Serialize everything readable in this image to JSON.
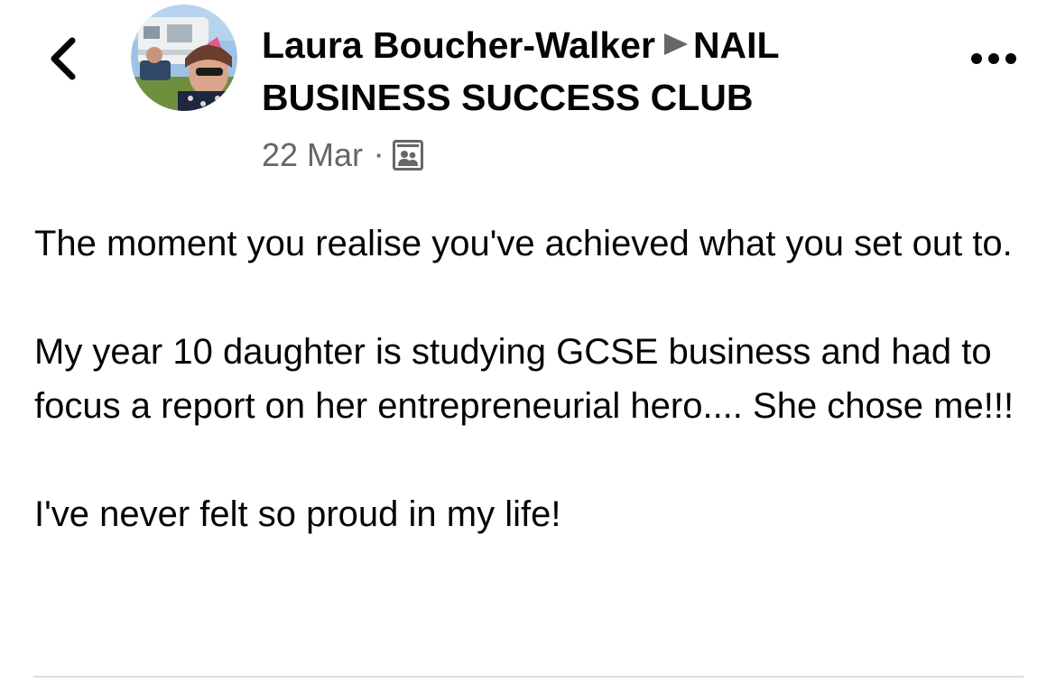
{
  "header": {
    "back_icon": "chevron-left-icon",
    "avatar_alt": "profile photo",
    "author": "Laura Boucher-Walker",
    "separator_icon": "play-triangle-icon",
    "group": "NAIL BUSINESS SUCCESS CLUB",
    "date": "22 Mar",
    "dot": "·",
    "audience_icon": "group-audience-icon",
    "more_icon": "more-horizontal-icon"
  },
  "post": {
    "paragraphs": [
      "The moment you realise you've achieved what you set out to.",
      "My year 10 daughter is studying GCSE business and had to focus a report on her entrepreneurial hero.... She chose me!!!",
      "I've never felt so proud in my life!"
    ]
  },
  "colors": {
    "text_primary": "#050505",
    "text_secondary": "#65676b",
    "divider": "#dcdde1"
  }
}
